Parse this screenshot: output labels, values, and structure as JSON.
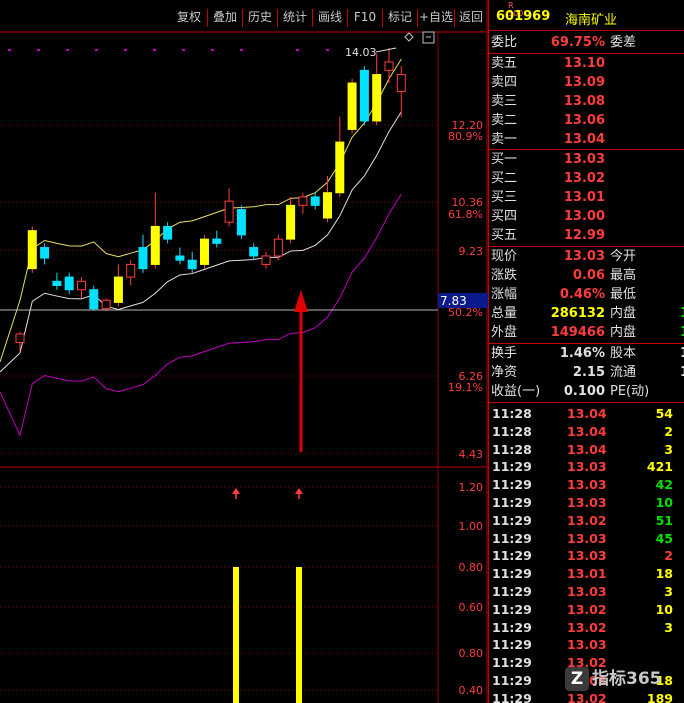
{
  "toolbar": {
    "items": [
      "复权",
      "叠加",
      "历史",
      "统计",
      "画线",
      "F10",
      "标记",
      "+自选",
      "返回"
    ]
  },
  "chart": {
    "price_labels": [
      "14.03",
      "12.20",
      "10.36",
      "9.23",
      "7.83",
      "6.26",
      "4.43"
    ],
    "pct_labels": [
      "80.9%",
      "61.8%",
      "50.2%",
      "19.1%"
    ],
    "ind_labels": [
      "1.20",
      "1.00",
      "0.80",
      "0.60",
      "0.80",
      "0.40"
    ],
    "candles": [
      {
        "o": 7.05,
        "c": 7.25,
        "h": 7.3,
        "l": 6.85
      },
      {
        "o": 8.8,
        "c": 9.7,
        "h": 9.8,
        "l": 8.7
      },
      {
        "o": 9.3,
        "c": 9.05,
        "h": 9.4,
        "l": 8.9
      },
      {
        "o": 8.5,
        "c": 8.4,
        "h": 8.7,
        "l": 8.3
      },
      {
        "o": 8.6,
        "c": 8.3,
        "h": 8.7,
        "l": 8.2
      },
      {
        "o": 8.3,
        "c": 8.5,
        "h": 8.6,
        "l": 8.1
      },
      {
        "o": 8.3,
        "c": 7.85,
        "h": 8.4,
        "l": 7.8
      },
      {
        "o": 7.85,
        "c": 8.05,
        "h": 8.1,
        "l": 7.8
      },
      {
        "o": 8.0,
        "c": 8.6,
        "h": 8.9,
        "l": 7.9
      },
      {
        "o": 8.6,
        "c": 8.9,
        "h": 9.0,
        "l": 8.4
      },
      {
        "o": 9.3,
        "c": 8.8,
        "h": 9.6,
        "l": 8.7
      },
      {
        "o": 8.9,
        "c": 9.8,
        "h": 10.6,
        "l": 8.8
      },
      {
        "o": 9.8,
        "c": 9.5,
        "h": 9.9,
        "l": 9.4
      },
      {
        "o": 9.1,
        "c": 9.0,
        "h": 9.3,
        "l": 8.9
      },
      {
        "o": 9.0,
        "c": 8.8,
        "h": 9.2,
        "l": 8.7
      },
      {
        "o": 8.9,
        "c": 9.5,
        "h": 9.6,
        "l": 8.8
      },
      {
        "o": 9.5,
        "c": 9.4,
        "h": 9.7,
        "l": 9.3
      },
      {
        "o": 9.9,
        "c": 10.4,
        "h": 10.7,
        "l": 9.8
      },
      {
        "o": 10.2,
        "c": 9.6,
        "h": 10.3,
        "l": 9.5
      },
      {
        "o": 9.3,
        "c": 9.1,
        "h": 9.4,
        "l": 9.0
      },
      {
        "o": 8.9,
        "c": 9.1,
        "h": 9.2,
        "l": 8.8
      },
      {
        "o": 9.1,
        "c": 9.5,
        "h": 9.6,
        "l": 9.0
      },
      {
        "o": 9.5,
        "c": 10.3,
        "h": 10.5,
        "l": 9.4
      },
      {
        "o": 10.3,
        "c": 10.5,
        "h": 10.6,
        "l": 10.1
      },
      {
        "o": 10.5,
        "c": 10.3,
        "h": 10.6,
        "l": 10.2
      },
      {
        "o": 10.0,
        "c": 10.6,
        "h": 11.0,
        "l": 9.9
      },
      {
        "o": 10.6,
        "c": 11.8,
        "h": 12.4,
        "l": 10.5
      },
      {
        "o": 12.1,
        "c": 13.2,
        "h": 13.3,
        "l": 12.0
      },
      {
        "o": 13.5,
        "c": 12.3,
        "h": 13.6,
        "l": 12.2
      },
      {
        "o": 12.3,
        "c": 13.4,
        "h": 13.9,
        "l": 12.2
      },
      {
        "o": 13.5,
        "c": 13.7,
        "h": 14.03,
        "l": 13.2
      },
      {
        "o": 13.0,
        "c": 13.4,
        "h": 13.6,
        "l": 12.4
      }
    ],
    "signals": [
      16,
      26
    ]
  },
  "quote": {
    "code": "601969",
    "name": "海南矿业",
    "logo_top": "R",
    "logo_bottom": "500",
    "weibi": {
      "label": "委比",
      "value": "69.75%",
      "label2": "委差"
    },
    "sells": [
      {
        "label": "卖五",
        "price": "13.10"
      },
      {
        "label": "卖四",
        "price": "13.09"
      },
      {
        "label": "卖三",
        "price": "13.08"
      },
      {
        "label": "卖二",
        "price": "13.06"
      },
      {
        "label": "卖一",
        "price": "13.04"
      }
    ],
    "buys": [
      {
        "label": "买一",
        "price": "13.03"
      },
      {
        "label": "买二",
        "price": "13.02"
      },
      {
        "label": "买三",
        "price": "13.01"
      },
      {
        "label": "买四",
        "price": "13.00"
      },
      {
        "label": "买五",
        "price": "12.99"
      }
    ],
    "stats": [
      {
        "l1": "现价",
        "v1": "13.03",
        "l2": "今开",
        "v2": "",
        "c1": "red",
        "c2": "red"
      },
      {
        "l1": "涨跌",
        "v1": "0.06",
        "l2": "最高",
        "v2": "",
        "c1": "red",
        "c2": "red"
      },
      {
        "l1": "涨幅",
        "v1": "0.46%",
        "l2": "最低",
        "v2": "",
        "c1": "red",
        "c2": "red"
      },
      {
        "l1": "总量",
        "v1": "286132",
        "l2": "内盘",
        "v2": "1",
        "c1": "yel",
        "c2": "grn"
      },
      {
        "l1": "外盘",
        "v1": "149466",
        "l2": "内盘",
        "v2": "1",
        "c1": "red",
        "c2": "grn"
      }
    ],
    "stats2": [
      {
        "l1": "换手",
        "v1": "1.46%",
        "l2": "股本",
        "v2": "1"
      },
      {
        "l1": "净资",
        "v1": "2.15",
        "l2": "流通",
        "v2": "1"
      },
      {
        "l1": "收益(一)",
        "v1": "0.100",
        "l2": "PE(动)",
        "v2": ""
      }
    ],
    "ticks": [
      {
        "t": "11:28",
        "p": "13.04",
        "v": "54",
        "c": "yel"
      },
      {
        "t": "11:28",
        "p": "13.04",
        "v": "2",
        "c": "yel"
      },
      {
        "t": "11:28",
        "p": "13.04",
        "v": "3",
        "c": "yel"
      },
      {
        "t": "11:29",
        "p": "13.03",
        "v": "421",
        "c": "yel"
      },
      {
        "t": "11:29",
        "p": "13.03",
        "v": "42",
        "c": "grn"
      },
      {
        "t": "11:29",
        "p": "13.03",
        "v": "10",
        "c": "grn"
      },
      {
        "t": "11:29",
        "p": "13.02",
        "v": "51",
        "c": "grn"
      },
      {
        "t": "11:29",
        "p": "13.03",
        "v": "45",
        "c": "grn"
      },
      {
        "t": "11:29",
        "p": "13.03",
        "v": "2",
        "c": "red"
      },
      {
        "t": "11:29",
        "p": "13.01",
        "v": "18",
        "c": "yel"
      },
      {
        "t": "11:29",
        "p": "13.03",
        "v": "3",
        "c": "yel"
      },
      {
        "t": "11:29",
        "p": "13.02",
        "v": "10",
        "c": "yel"
      },
      {
        "t": "11:29",
        "p": "13.02",
        "v": "3",
        "c": "yel"
      },
      {
        "t": "11:29",
        "p": "13.03",
        "v": "",
        "c": "yel"
      },
      {
        "t": "11:29",
        "p": "13.02",
        "v": "",
        "c": "yel"
      },
      {
        "t": "11:29",
        "p": "13.03",
        "v": "18",
        "c": "yel"
      },
      {
        "t": "11:29",
        "p": "13.02",
        "v": "189",
        "c": "yel"
      }
    ]
  },
  "watermark": {
    "logo": "Z",
    "text": "指标365"
  }
}
